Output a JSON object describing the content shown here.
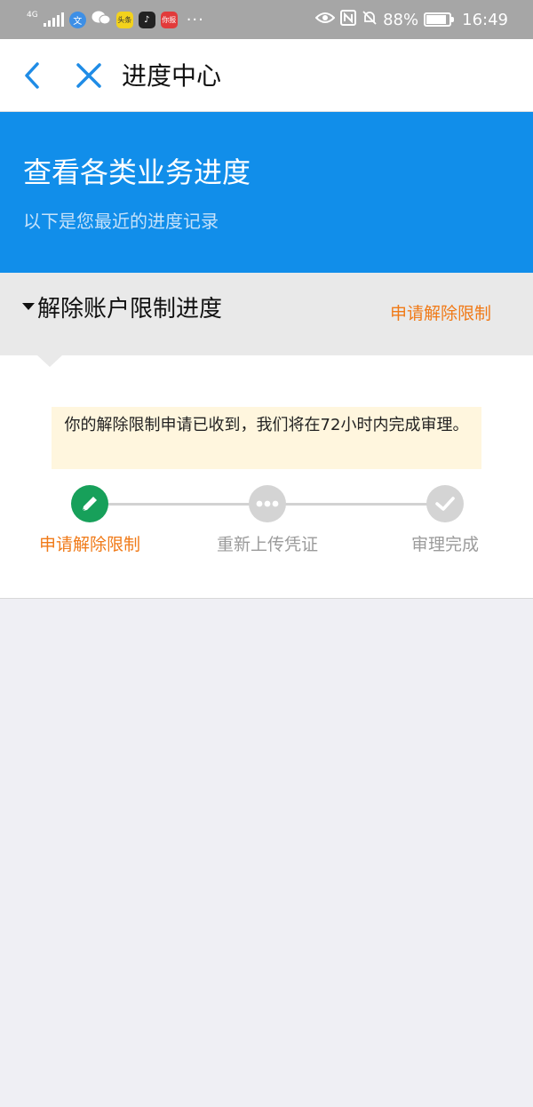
{
  "status_bar": {
    "network": "4G",
    "app_icons": [
      {
        "name": "translate-app-icon",
        "glyph": "文",
        "color": "#3d8fe6"
      },
      {
        "name": "wechat-icon",
        "glyph": "",
        "color": "#a6a6a6"
      },
      {
        "name": "news-app-icon",
        "glyph": "头条",
        "color": "#f3d21c"
      },
      {
        "name": "tiktok-icon",
        "glyph": "♪",
        "color": "#222222"
      },
      {
        "name": "report-app-icon",
        "glyph": "你报",
        "color": "#e23b3b"
      }
    ],
    "more": "···",
    "battery": "88%",
    "battery_level": 0.88,
    "time": "16:49"
  },
  "nav": {
    "title": "进度中心"
  },
  "banner": {
    "title": "查看各类业务进度",
    "subtitle": "以下是您最近的进度记录"
  },
  "section": {
    "title": "解除账户限制进度",
    "action": "申请解除限制"
  },
  "notice": {
    "text": "你的解除限制申请已收到，我们将在72小时内完成审理。"
  },
  "steps": [
    {
      "label": "申请解除限制",
      "state": "done",
      "icon": "pencil-icon"
    },
    {
      "label": "重新上传凭证",
      "state": "pending",
      "icon": "more-dots-icon"
    },
    {
      "label": "审理完成",
      "state": "pending",
      "icon": "check-icon"
    }
  ],
  "colors": {
    "banner": "#118eea",
    "accent": "#f07a18",
    "step_done": "#17a05a",
    "step_pending": "#d4d4d4",
    "nav_icon": "#1f8ce6"
  }
}
